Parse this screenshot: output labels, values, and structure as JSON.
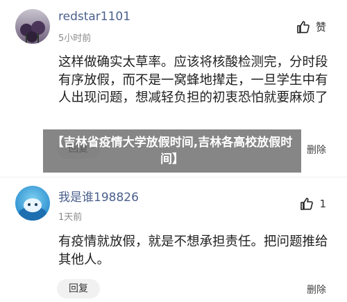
{
  "comments": [
    {
      "username": "redstar1101",
      "time": "5小时前",
      "like_label": "赞",
      "body": "这样做确实太草率。应该将核酸检测完，分时段有序放假，而不是一窝蜂地撵走，一旦学生中有人出现问题，想减轻负担的初衷恐怕就要麻烦了",
      "reply_label": "回复",
      "delete_label": "删除"
    },
    {
      "username": "我是谁198826",
      "time": "1天前",
      "like_count": "1",
      "body": "有疫情就放假，就是不想承担责任。把问题推给其他人。",
      "reply_label": "回复",
      "delete_label": "删除"
    }
  ],
  "banner": {
    "text": "【吉林省疫情大学放假时间,吉林各高校放假时间】"
  },
  "colors": {
    "username": "#4a5f8c",
    "banner_bg": "#646464"
  }
}
